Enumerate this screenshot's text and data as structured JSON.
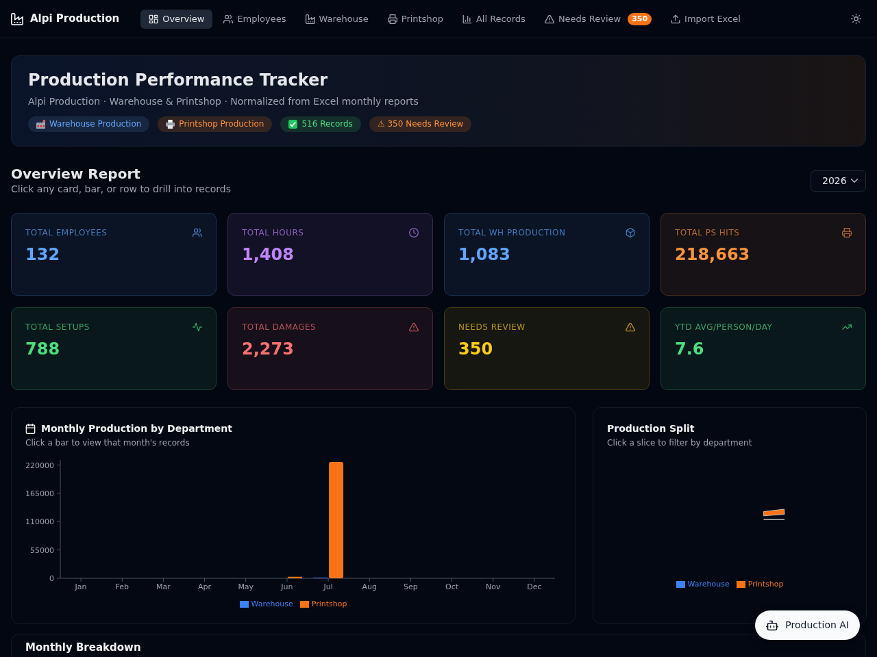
{
  "navbar": {
    "brand": "Alpi Production",
    "items": [
      {
        "label": "Overview",
        "selected": true
      },
      {
        "label": "Employees",
        "selected": false
      },
      {
        "label": "Warehouse",
        "selected": false
      },
      {
        "label": "Printshop",
        "selected": false
      },
      {
        "label": "All Records",
        "selected": false
      },
      {
        "label": "Needs Review",
        "selected": false,
        "badge": "350"
      },
      {
        "label": "Import Excel",
        "selected": false
      }
    ]
  },
  "hero": {
    "title": "Production Performance Tracker",
    "subtitle": "Alpi Production · Warehouse & Printshop · Normalized from Excel monthly reports",
    "tags": [
      {
        "label": "Warehouse Production",
        "color": "#60a5fa"
      },
      {
        "label": "Printshop Production",
        "color": "#fb923c"
      },
      {
        "label": "516 Records",
        "color": "#4ade80"
      },
      {
        "label": "⚠ 350 Needs Review",
        "color": "#fb923c"
      }
    ]
  },
  "overview": {
    "title": "Overview Report",
    "subtitle": "Click any card, bar, or row to drill into records",
    "year": "2026"
  },
  "stat_cards": [
    {
      "label": "TOTAL EMPLOYEES",
      "value": "132",
      "color": "#60a5fa"
    },
    {
      "label": "TOTAL HOURS",
      "value": "1,408",
      "color": "#c084fc"
    },
    {
      "label": "TOTAL WH PRODUCTION",
      "value": "1,083",
      "color": "#60a5fa"
    },
    {
      "label": "TOTAL PS HITS",
      "value": "218,663",
      "color": "#fb923c"
    },
    {
      "label": "TOTAL SETUPS",
      "value": "788",
      "color": "#4ade80"
    },
    {
      "label": "TOTAL DAMAGES",
      "value": "2,273",
      "color": "#f87171"
    },
    {
      "label": "NEEDS REVIEW",
      "value": "350",
      "color": "#facc15"
    },
    {
      "label": "YTD AVG/PERSON/DAY",
      "value": "7.6",
      "color": "#4ade80"
    }
  ],
  "monthly_chart": {
    "title": "Monthly Production by Department",
    "subtitle": "Click a bar to view that month's records",
    "chart_data": {
      "type": "bar",
      "categories": [
        "Jan",
        "Feb",
        "Mar",
        "Apr",
        "May",
        "Jun",
        "Jul",
        "Aug",
        "Sep",
        "Oct",
        "Nov",
        "Dec"
      ],
      "series": [
        {
          "name": "Warehouse",
          "color": "#3b82f6",
          "values": [
            0,
            0,
            0,
            0,
            0,
            0,
            1000,
            0,
            0,
            0,
            0,
            0
          ]
        },
        {
          "name": "Printshop",
          "color": "#f97316",
          "values": [
            0,
            0,
            0,
            0,
            0,
            3000,
            226000,
            0,
            0,
            0,
            0,
            0
          ]
        }
      ],
      "ylim": [
        0,
        230000
      ],
      "yticks": [
        0,
        55000,
        110000,
        165000,
        220000
      ],
      "legend": "bottom"
    }
  },
  "production_split": {
    "title": "Production Split",
    "subtitle": "Click a slice to filter by department",
    "legend": [
      {
        "label": "Warehouse",
        "color": "#3b82f6"
      },
      {
        "label": "Printshop",
        "color": "#f97316"
      }
    ]
  },
  "monthly_breakdown": {
    "title": "Monthly Breakdown"
  },
  "assistant_button": {
    "label": "Production AI"
  }
}
